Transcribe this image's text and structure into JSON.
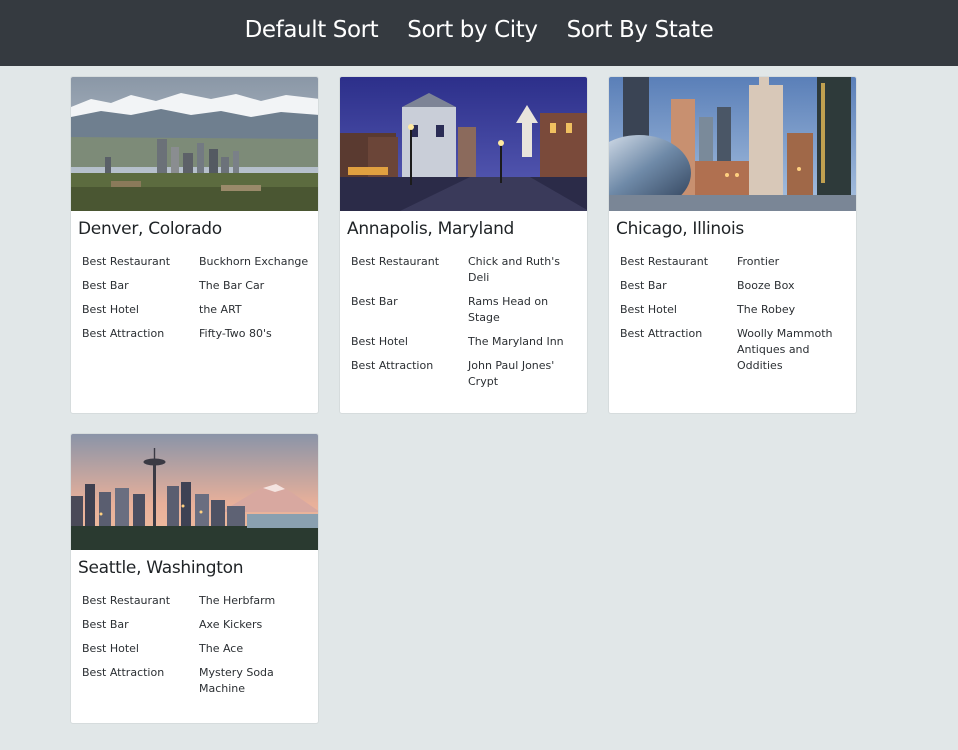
{
  "nav": {
    "links": [
      "Default Sort",
      "Sort by City",
      "Sort By State"
    ]
  },
  "cards": [
    {
      "title": "Denver, Colorado",
      "rows": [
        {
          "label": "Best Restaurant",
          "value": "Buckhorn Exchange"
        },
        {
          "label": "Best Bar",
          "value": "The Bar Car"
        },
        {
          "label": "Best Hotel",
          "value": "the ART"
        },
        {
          "label": "Best Attraction",
          "value": "Fifty-Two 80's"
        }
      ]
    },
    {
      "title": "Annapolis, Maryland",
      "rows": [
        {
          "label": "Best Restaurant",
          "value": "Chick and Ruth's Deli"
        },
        {
          "label": "Best Bar",
          "value": "Rams Head on Stage"
        },
        {
          "label": "Best Hotel",
          "value": "The Maryland Inn"
        },
        {
          "label": "Best Attraction",
          "value": "John Paul Jones' Crypt"
        }
      ]
    },
    {
      "title": "Chicago, Illinois",
      "rows": [
        {
          "label": "Best Restaurant",
          "value": "Frontier"
        },
        {
          "label": "Best Bar",
          "value": "Booze Box"
        },
        {
          "label": "Best Hotel",
          "value": "The Robey"
        },
        {
          "label": "Best Attraction",
          "value": "Woolly Mammoth Antiques and Oddities"
        }
      ]
    },
    {
      "title": "Seattle, Washington",
      "rows": [
        {
          "label": "Best Restaurant",
          "value": "The Herbfarm"
        },
        {
          "label": "Best Bar",
          "value": "Axe Kickers"
        },
        {
          "label": "Best Hotel",
          "value": "The Ace"
        },
        {
          "label": "Best Attraction",
          "value": "Mystery Soda Machine"
        }
      ]
    }
  ]
}
